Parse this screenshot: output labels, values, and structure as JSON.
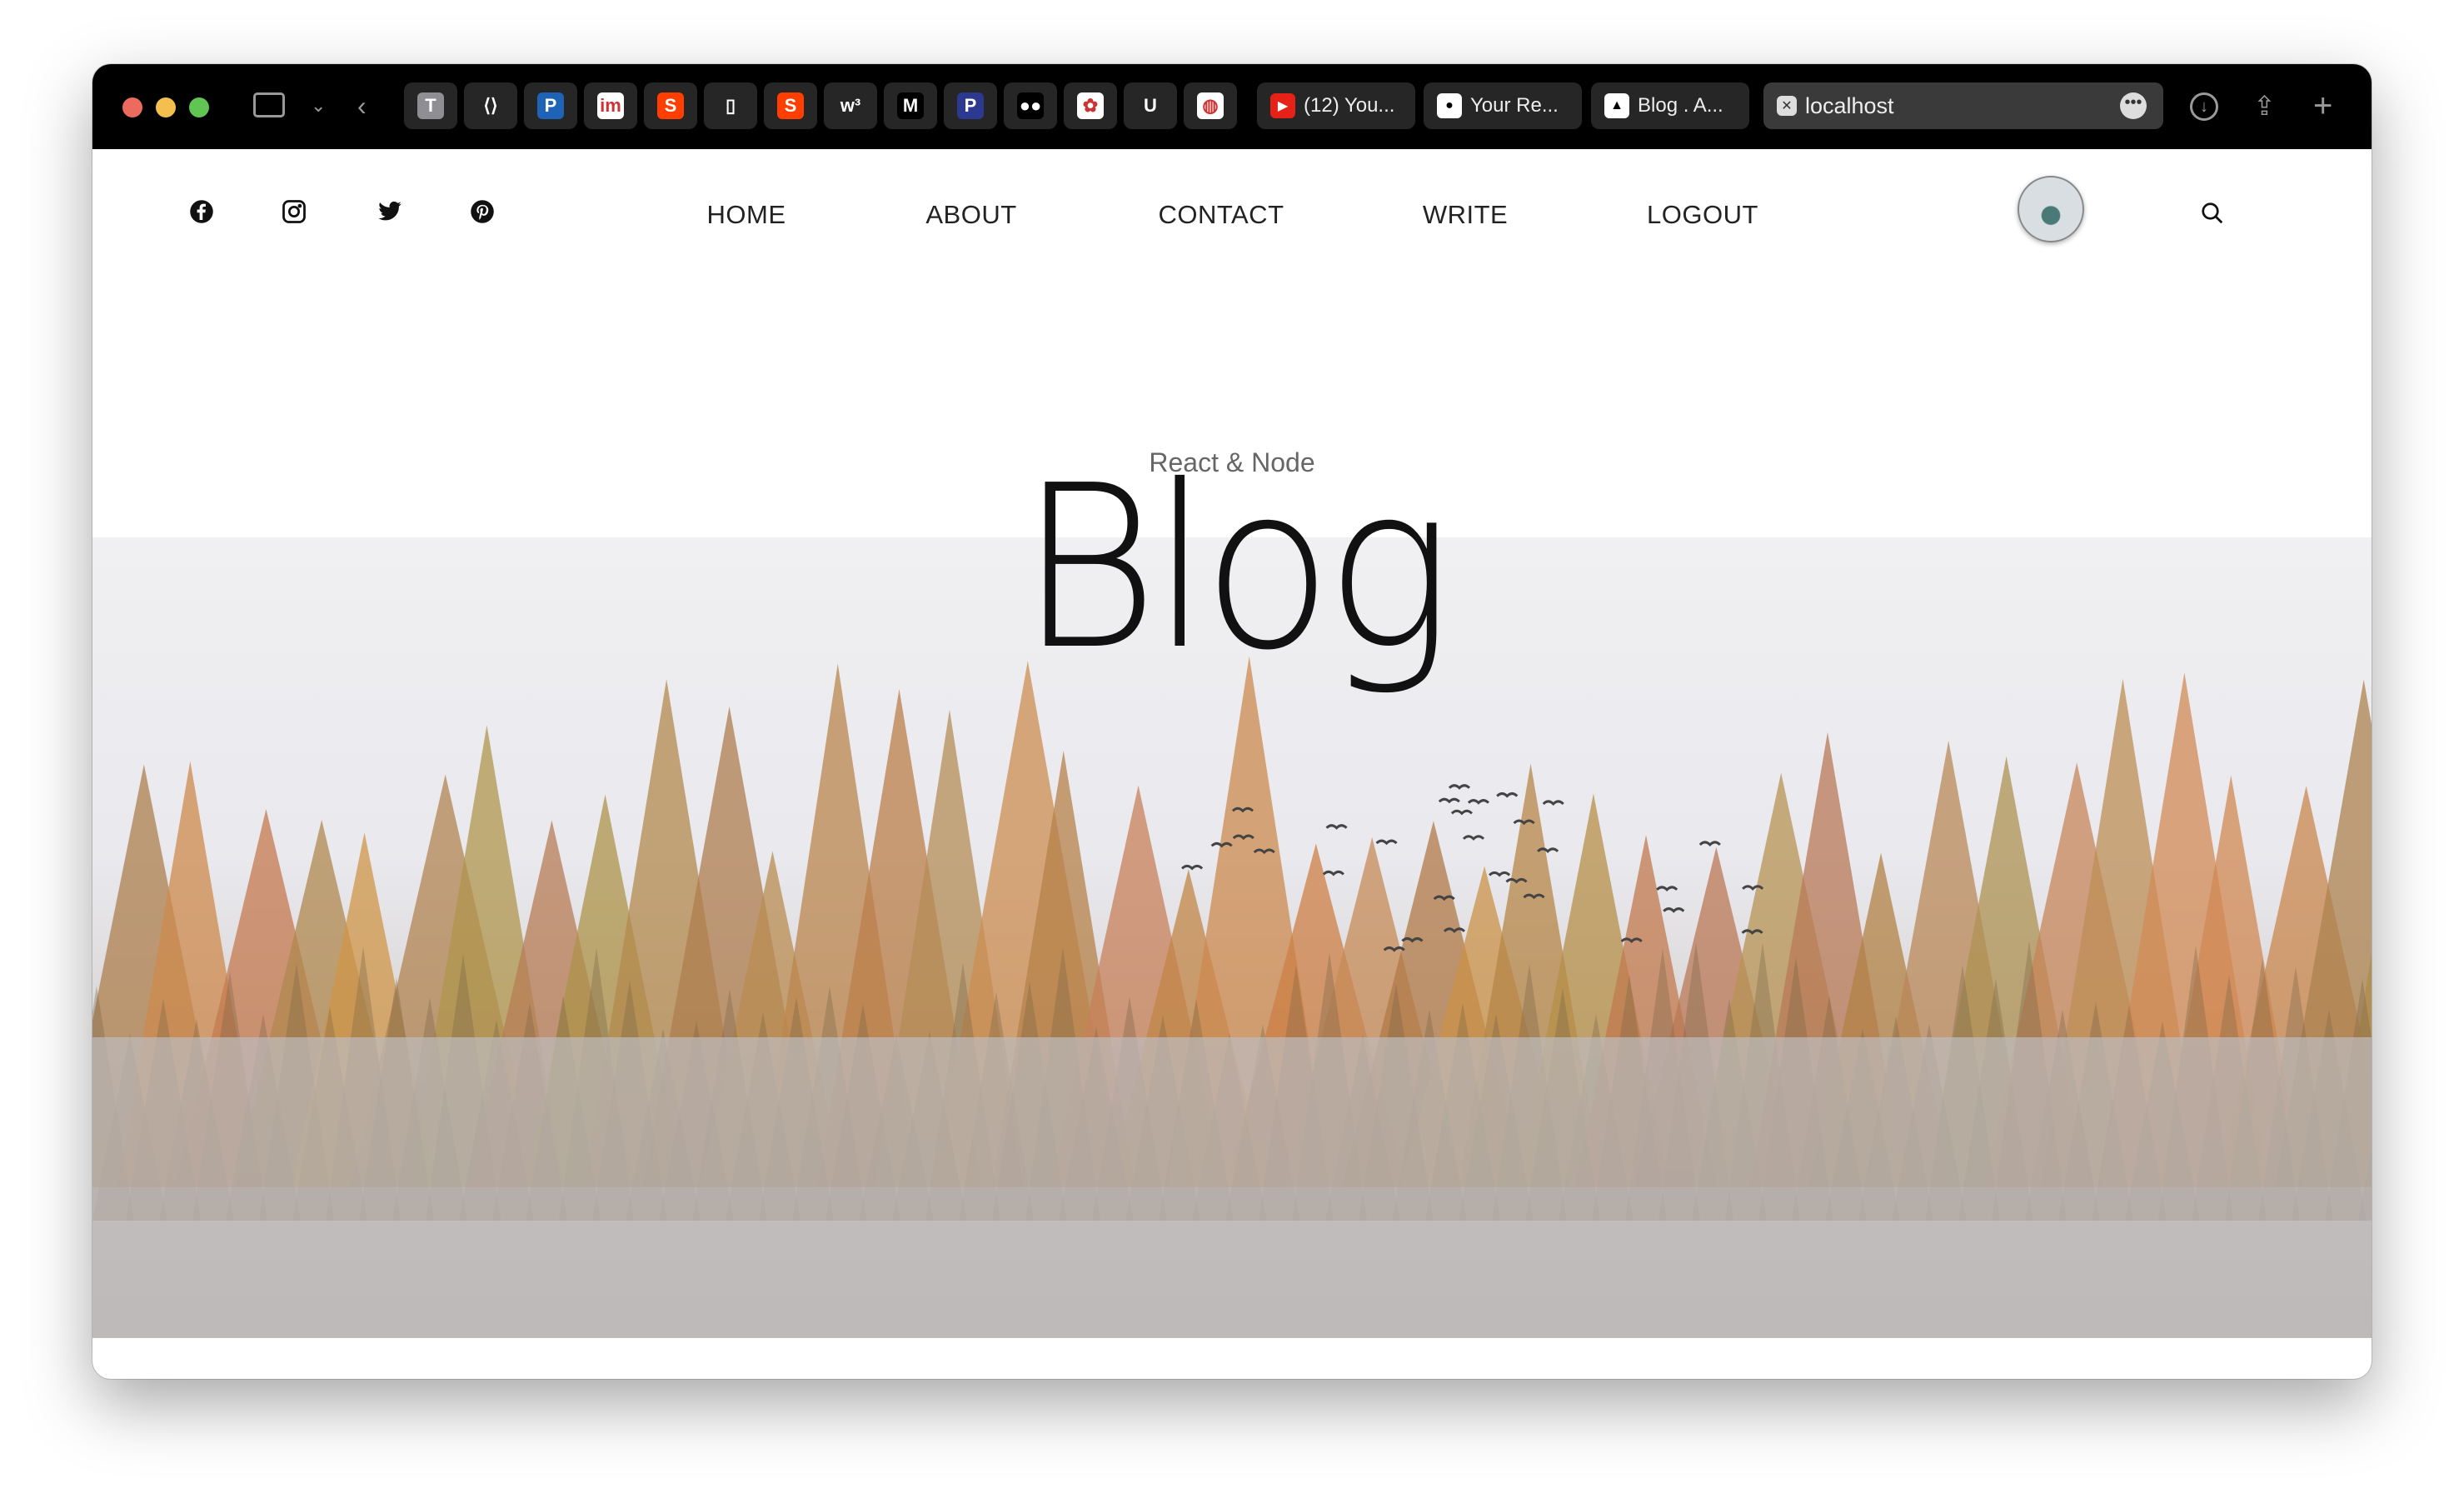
{
  "browser": {
    "favorites": [
      {
        "name": "typora",
        "letter": "T",
        "color": "#8e8e93"
      },
      {
        "name": "code-brackets",
        "letter": "⟨⟩",
        "color": "#262626"
      },
      {
        "name": "p-app",
        "letter": "P",
        "color": "#1e63b5"
      },
      {
        "name": "im",
        "letter": "im",
        "color": "#ffffff"
      },
      {
        "name": "svelte",
        "letter": "S",
        "color": "#ff3e00"
      },
      {
        "name": "green-app",
        "letter": "▯",
        "color": "#262626"
      },
      {
        "name": "svelte-2",
        "letter": "S",
        "color": "#ff3e00"
      },
      {
        "name": "w3schools",
        "letter": "w³",
        "color": "#262626"
      },
      {
        "name": "m-app",
        "letter": "M",
        "color": "#000000"
      },
      {
        "name": "p-app-2",
        "letter": "P",
        "color": "#2b3990"
      },
      {
        "name": "medium",
        "letter": "●●",
        "color": "#000000"
      },
      {
        "name": "colorful-app",
        "letter": "✿",
        "color": "#ffffff"
      },
      {
        "name": "udacity",
        "letter": "U",
        "color": "#262626"
      },
      {
        "name": "dribbble",
        "letter": "◍",
        "color": "#ffffff"
      }
    ],
    "tabs": [
      {
        "label": "(12) You...",
        "icon": "youtube-icon"
      },
      {
        "label": "Your Re...",
        "icon": "github-icon"
      },
      {
        "label": "Blog . A...",
        "icon": "triangle-logo-icon"
      }
    ],
    "active_tab": {
      "label": "localhost"
    }
  },
  "nav": {
    "social": [
      "facebook-icon",
      "instagram-icon",
      "twitter-icon",
      "pinterest-icon"
    ],
    "links": [
      "HOME",
      "ABOUT",
      "CONTACT",
      "WRITE",
      "LOGOUT"
    ]
  },
  "header": {
    "subtitle": "React & Node",
    "title": "Blog"
  }
}
